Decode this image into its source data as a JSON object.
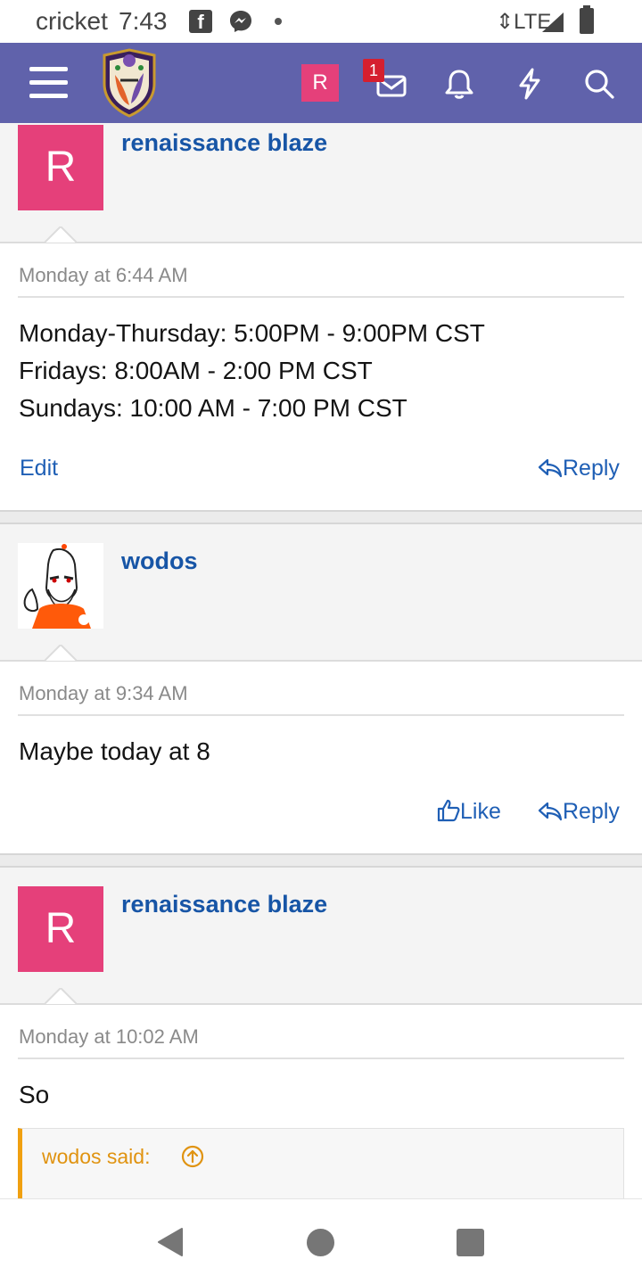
{
  "status_bar": {
    "carrier": "cricket",
    "time": "7:43",
    "network": "LTE"
  },
  "nav": {
    "avatar_letter": "R",
    "inbox_badge": "1",
    "accent_color": "#6062ab",
    "icons": [
      "menu-icon",
      "site-logo",
      "inbox-icon",
      "bell-icon",
      "bolt-icon",
      "search-icon"
    ]
  },
  "posts": [
    {
      "avatar_letter": "R",
      "username": "renaissance blaze",
      "timestamp": "Monday at 6:44 AM",
      "lines": [
        "Monday-Thursday: 5:00PM - 9:00PM CST",
        "Fridays: 8:00AM - 2:00 PM CST",
        "Sundays: 10:00 AM - 7:00 PM CST"
      ],
      "edit_label": "Edit",
      "reply_label": "Reply"
    },
    {
      "username": "wodos",
      "timestamp": "Monday at 9:34 AM",
      "lines": [
        "Maybe today at 8"
      ],
      "like_label": "Like",
      "reply_label": "Reply"
    },
    {
      "avatar_letter": "R",
      "username": "renaissance blaze",
      "timestamp": "Monday at 10:02 AM",
      "lines": [
        "So"
      ],
      "quote_author": "wodos said:"
    }
  ]
}
